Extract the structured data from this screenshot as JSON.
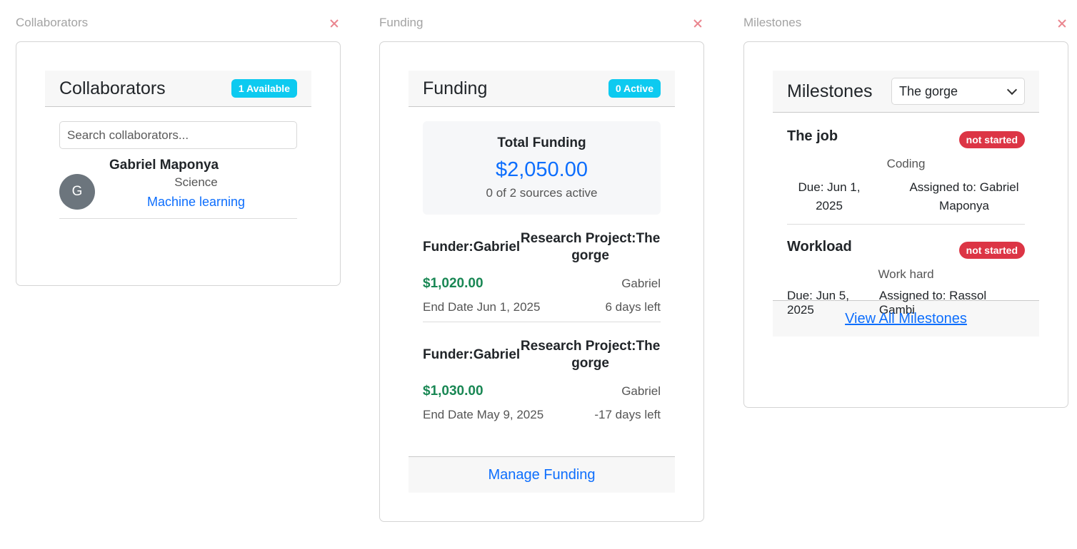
{
  "collaborators_widget": {
    "title": "Collaborators",
    "card_title": "Collaborators",
    "badge": "1 Available",
    "search_placeholder": "Search collaborators...",
    "items": [
      {
        "initial": "G",
        "name": "Gabriel Maponya",
        "department": "Science",
        "interest": "Machine learning"
      }
    ]
  },
  "funding_widget": {
    "title": "Funding",
    "card_title": "Funding",
    "badge": "0 Active",
    "total_label": "Total Funding",
    "total_amount": "$2,050.00",
    "total_sub": "0 of 2 sources active",
    "items": [
      {
        "funder": "Funder:Gabriel",
        "project": "Research Project:The gorge",
        "amount": "$1,020.00",
        "owner": "Gabriel",
        "end_date": "End Date Jun 1, 2025",
        "days_left": "6 days left"
      },
      {
        "funder": "Funder:Gabriel",
        "project": "Research Project:The gorge",
        "amount": "$1,030.00",
        "owner": "Gabriel",
        "end_date": "End Date May 9, 2025",
        "days_left": "-17 days left"
      }
    ],
    "footer_link": "Manage Funding"
  },
  "milestones_widget": {
    "title": "Milestones",
    "card_title": "Milestones",
    "select_value": "The gorge",
    "items": [
      {
        "title": "The job",
        "status": "not started",
        "description": "Coding",
        "due": "Due: Jun 1, 2025",
        "assigned": "Assigned to: Gabriel Maponya"
      },
      {
        "title": "Workload",
        "status": "not started",
        "description": "Work hard",
        "due": "Due: Jun 5, 2025",
        "assigned": "Assigned to: Rassol Gambi"
      }
    ],
    "footer_link": "View All Milestones"
  },
  "colors": {
    "accent": "#0d6efd",
    "info_badge": "#0dcaf0",
    "danger_badge": "#dc3545",
    "success_text": "#198754"
  }
}
